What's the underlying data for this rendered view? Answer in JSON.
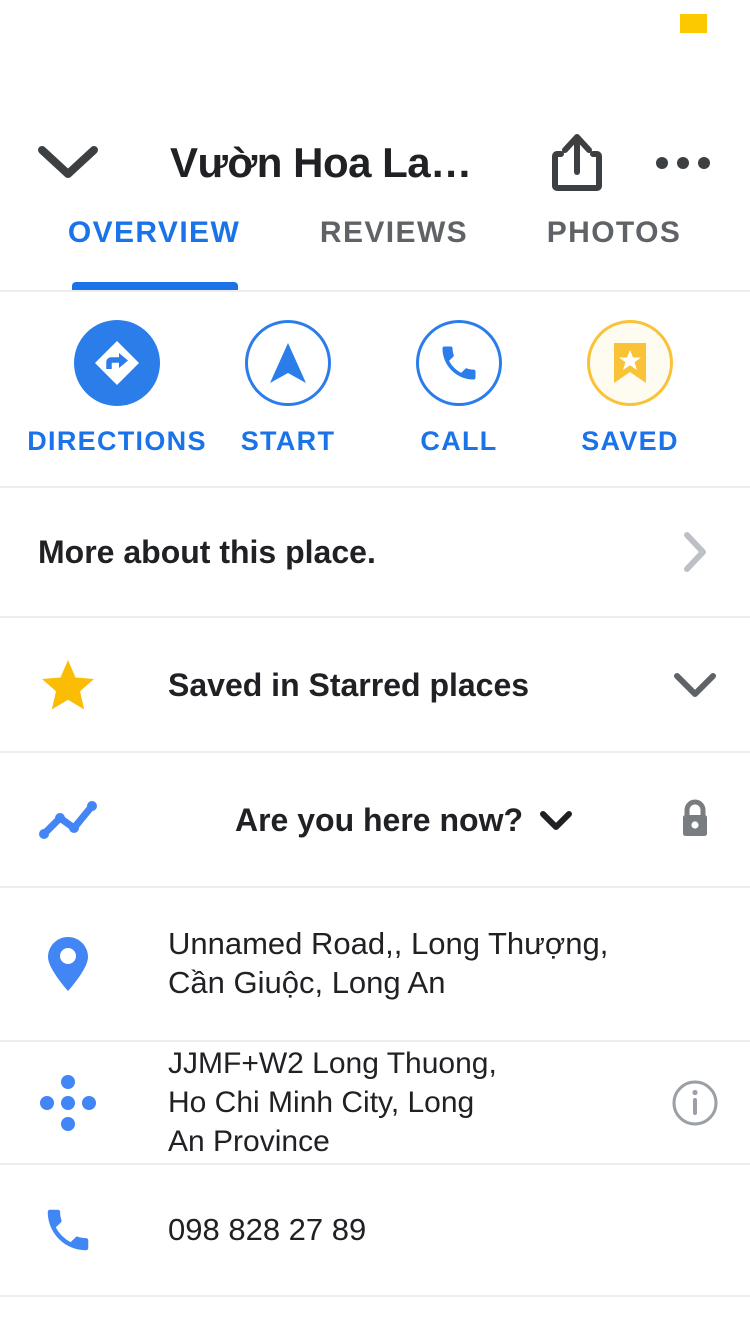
{
  "status": {
    "marker_color": "#FCC900"
  },
  "header": {
    "back_icon": "chevron-down-icon",
    "title": "Vườn Hoa La…",
    "share_icon": "share-icon",
    "more_icon": "overflow-menu-icon"
  },
  "tabs": {
    "items": [
      {
        "label": "OVERVIEW",
        "active": true
      },
      {
        "label": "REVIEWS",
        "active": false
      },
      {
        "label": "PHOTOS",
        "active": false
      }
    ],
    "active_color": "#1A73E8",
    "inactive_color": "#5F6368"
  },
  "actions": [
    {
      "label": "DIRECTIONS",
      "icon": "directions-icon",
      "style": "filled"
    },
    {
      "label": "START",
      "icon": "navigation-arrow-icon",
      "style": "outline"
    },
    {
      "label": "CALL",
      "icon": "phone-icon",
      "style": "outline"
    },
    {
      "label": "SAVED",
      "icon": "bookmark-star-icon",
      "style": "saved"
    }
  ],
  "rows": {
    "more_about": {
      "label": "More about this place.",
      "accessory_icon": "chevron-right-icon"
    },
    "saved_in": {
      "icon": "star-icon",
      "label": "Saved in Starred places",
      "accessory_icon": "chevron-down-icon"
    },
    "here_now": {
      "icon": "trending-line-icon",
      "label": "Are you here now?",
      "inline_icon": "chevron-down-icon",
      "accessory_icon": "lock-icon"
    },
    "address": {
      "icon": "map-pin-icon",
      "line1": "Unnamed Road,, Long Thượng,",
      "line2": "Cần Giuộc, Long An"
    },
    "plus_code": {
      "icon": "plus-code-icon",
      "line1": "JJMF+W2 Long Thuong,",
      "line2": "Ho Chi Minh City, Long",
      "line3": "An Province",
      "accessory_icon": "info-icon"
    },
    "phone": {
      "icon": "phone-icon",
      "number": "098 828 27 89"
    }
  },
  "colors": {
    "blue": "#1A73E8",
    "icon_blue": "#4285F4",
    "yellow": "#F9C237",
    "star_yellow": "#FBBC04",
    "text": "#202124",
    "gray": "#5F6368",
    "divider": "#EDEDED"
  }
}
